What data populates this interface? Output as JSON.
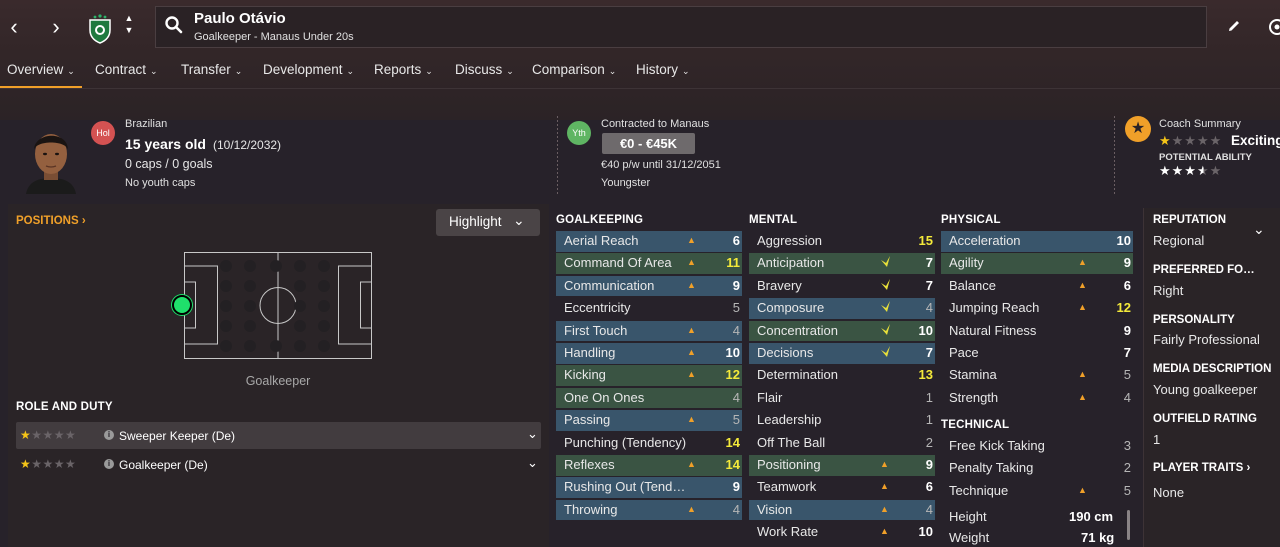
{
  "header": {
    "player_name": "Paulo Otávio",
    "subtitle": "Goalkeeper - Manaus Under 20s"
  },
  "menu": [
    {
      "label": "Overview"
    },
    {
      "label": "Contract"
    },
    {
      "label": "Transfer"
    },
    {
      "label": "Development"
    },
    {
      "label": "Reports"
    },
    {
      "label": "Discuss"
    },
    {
      "label": "Comparison"
    },
    {
      "label": "History"
    }
  ],
  "profile": {
    "badge": "Hol",
    "nationality": "Brazilian",
    "age": "15 years old",
    "dob": "(10/12/2032)",
    "caps": "0 caps / 0 goals",
    "youth_caps": "No youth caps"
  },
  "contract": {
    "badge": "Yth",
    "contracted": "Contracted to Manaus",
    "value": "€0 - €45K",
    "wage": "€40 p/w until 31/12/2051",
    "status": "Youngster"
  },
  "coach": {
    "label": "Coach Summary",
    "rating_text": "Exciting",
    "current_stars": 1,
    "potential_label": "POTENTIAL ABILITY",
    "potential_stars": 3.5
  },
  "positions": {
    "title": "POSITIONS",
    "highlight_label": "Highlight",
    "position_label": "Goalkeeper"
  },
  "roles": {
    "title": "ROLE AND DUTY",
    "items": [
      {
        "label": "Sweeper Keeper (De)",
        "stars": 1
      },
      {
        "label": "Goalkeeper (De)",
        "stars": 1
      }
    ]
  },
  "goalkeeping": {
    "title": "GOALKEEPING",
    "attrs": [
      {
        "name": "Aerial Reach",
        "value": "6",
        "hl": "blue",
        "arrow": "up",
        "color": "white"
      },
      {
        "name": "Command Of Area",
        "value": "11",
        "hl": "green",
        "arrow": "up",
        "color": "yellow"
      },
      {
        "name": "Communication",
        "value": "9",
        "hl": "blue",
        "arrow": "up",
        "color": "white"
      },
      {
        "name": "Eccentricity",
        "value": "5",
        "hl": "",
        "arrow": "",
        "color": "dim"
      },
      {
        "name": "First Touch",
        "value": "4",
        "hl": "blue",
        "arrow": "up",
        "color": "dim"
      },
      {
        "name": "Handling",
        "value": "10",
        "hl": "blue",
        "arrow": "up",
        "color": "white"
      },
      {
        "name": "Kicking",
        "value": "12",
        "hl": "green",
        "arrow": "up",
        "color": "yellow"
      },
      {
        "name": "One On Ones",
        "value": "4",
        "hl": "green",
        "arrow": "",
        "color": "dim"
      },
      {
        "name": "Passing",
        "value": "5",
        "hl": "blue",
        "arrow": "up",
        "color": "dim"
      },
      {
        "name": "Punching (Tendency)",
        "value": "14",
        "hl": "",
        "arrow": "",
        "color": "yellow"
      },
      {
        "name": "Reflexes",
        "value": "14",
        "hl": "green",
        "arrow": "up",
        "color": "yellow"
      },
      {
        "name": "Rushing Out (Tend…",
        "value": "9",
        "hl": "blue",
        "arrow": "",
        "color": "white"
      },
      {
        "name": "Throwing",
        "value": "4",
        "hl": "blue",
        "arrow": "up",
        "color": "dim"
      }
    ]
  },
  "mental": {
    "title": "MENTAL",
    "attrs": [
      {
        "name": "Aggression",
        "value": "15",
        "hl": "",
        "arrow": "",
        "color": "yellow"
      },
      {
        "name": "Anticipation",
        "value": "7",
        "hl": "green",
        "arrow": "tick",
        "color": "white"
      },
      {
        "name": "Bravery",
        "value": "7",
        "hl": "",
        "arrow": "tick",
        "color": "white"
      },
      {
        "name": "Composure",
        "value": "4",
        "hl": "blue",
        "arrow": "tick",
        "color": "dim"
      },
      {
        "name": "Concentration",
        "value": "10",
        "hl": "green",
        "arrow": "tick",
        "color": "white"
      },
      {
        "name": "Decisions",
        "value": "7",
        "hl": "blue",
        "arrow": "tick",
        "color": "white"
      },
      {
        "name": "Determination",
        "value": "13",
        "hl": "",
        "arrow": "",
        "color": "yellow"
      },
      {
        "name": "Flair",
        "value": "1",
        "hl": "",
        "arrow": "",
        "color": "dim"
      },
      {
        "name": "Leadership",
        "value": "1",
        "hl": "",
        "arrow": "",
        "color": "dim"
      },
      {
        "name": "Off The Ball",
        "value": "2",
        "hl": "",
        "arrow": "",
        "color": "dim"
      },
      {
        "name": "Positioning",
        "value": "9",
        "hl": "green",
        "arrow": "up",
        "color": "white"
      },
      {
        "name": "Teamwork",
        "value": "6",
        "hl": "",
        "arrow": "up",
        "color": "white"
      },
      {
        "name": "Vision",
        "value": "4",
        "hl": "blue",
        "arrow": "up",
        "color": "dim"
      },
      {
        "name": "Work Rate",
        "value": "10",
        "hl": "",
        "arrow": "up",
        "color": "white"
      }
    ]
  },
  "physical": {
    "title": "PHYSICAL",
    "attrs": [
      {
        "name": "Acceleration",
        "value": "10",
        "hl": "blue",
        "arrow": "",
        "color": "white"
      },
      {
        "name": "Agility",
        "value": "9",
        "hl": "green",
        "arrow": "up",
        "color": "white"
      },
      {
        "name": "Balance",
        "value": "6",
        "hl": "",
        "arrow": "up",
        "color": "white"
      },
      {
        "name": "Jumping Reach",
        "value": "12",
        "hl": "",
        "arrow": "up",
        "color": "yellow"
      },
      {
        "name": "Natural Fitness",
        "value": "9",
        "hl": "",
        "arrow": "",
        "color": "white"
      },
      {
        "name": "Pace",
        "value": "7",
        "hl": "",
        "arrow": "",
        "color": "white"
      },
      {
        "name": "Stamina",
        "value": "5",
        "hl": "",
        "arrow": "up",
        "color": "dim"
      },
      {
        "name": "Strength",
        "value": "4",
        "hl": "",
        "arrow": "up",
        "color": "dim"
      }
    ]
  },
  "technical": {
    "title": "TECHNICAL",
    "attrs": [
      {
        "name": "Free Kick Taking",
        "value": "3",
        "hl": "",
        "arrow": "",
        "color": "dim"
      },
      {
        "name": "Penalty Taking",
        "value": "2",
        "hl": "",
        "arrow": "",
        "color": "dim"
      },
      {
        "name": "Technique",
        "value": "5",
        "hl": "",
        "arrow": "up",
        "color": "dim"
      }
    ]
  },
  "body": {
    "height_label": "Height",
    "height": "190 cm",
    "weight_label": "Weight",
    "weight": "71 kg"
  },
  "right_panel": [
    {
      "label": "REPUTATION",
      "value": "Regional"
    },
    {
      "label": "PREFERRED FO…",
      "value": "Right"
    },
    {
      "label": "PERSONALITY",
      "value": "Fairly Professional"
    },
    {
      "label": "MEDIA DESCRIPTION",
      "value": "Young goalkeeper"
    },
    {
      "label": "OUTFIELD RATING",
      "value": "1"
    },
    {
      "label": "PLAYER TRAITS",
      "value": "None"
    }
  ],
  "colors": {
    "accent": "#f0a029",
    "highlight_blue": "#39556b",
    "highlight_green": "#3a5443",
    "value_yellow": "#f4ea3a",
    "position_green": "#1fe06b"
  }
}
